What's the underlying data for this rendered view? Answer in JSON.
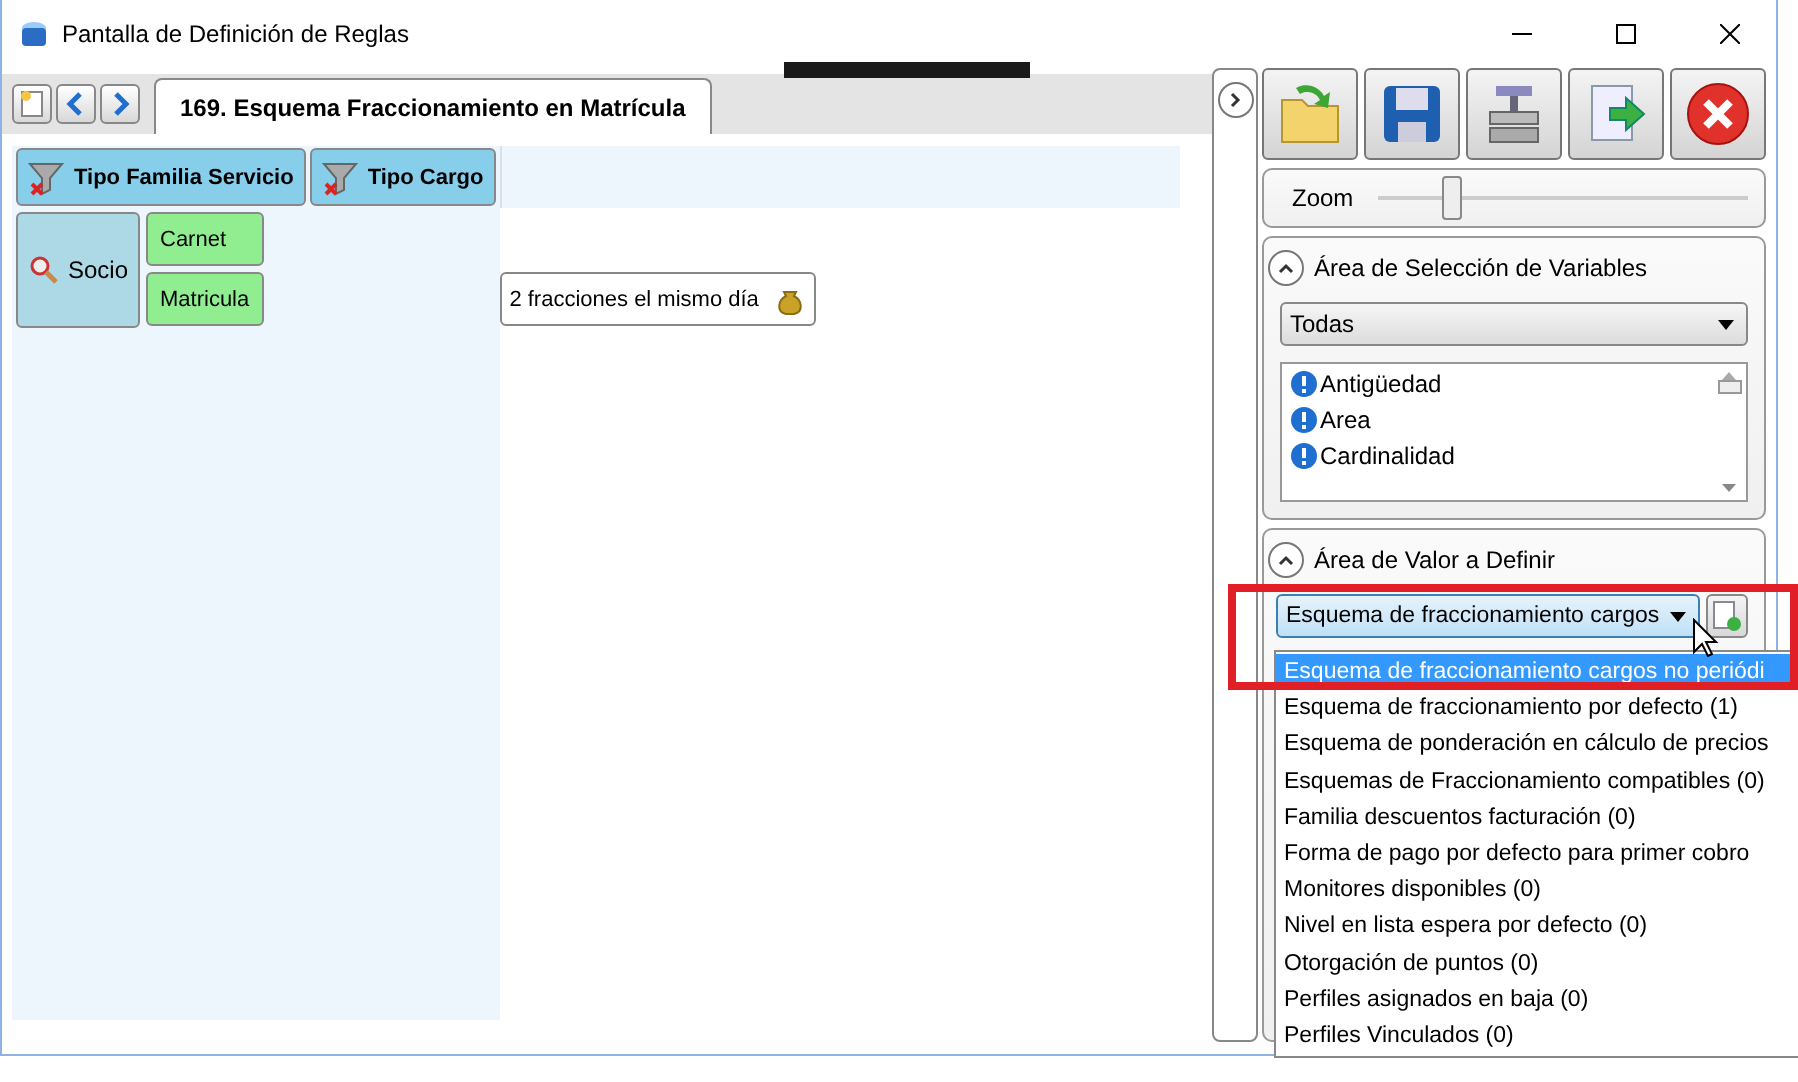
{
  "window": {
    "title": "Pantalla de Definición de Reglas"
  },
  "tabs": [
    {
      "label": "169. Esquema Fraccionamiento en Matrícula",
      "selected": true
    }
  ],
  "grid": {
    "column_headers": [
      "Tipo Familia Servicio",
      "Tipo Cargo"
    ],
    "row_header": "Socio",
    "row_values": [
      {
        "label": "Carnet"
      },
      {
        "label": "Matricula",
        "result": "2 fracciones el mismo día"
      }
    ]
  },
  "zoom": {
    "label": "Zoom",
    "level": 0.2
  },
  "variables": {
    "title": "Área de Selección de Variables",
    "filter": "Todas",
    "items": [
      "Antigüedad",
      "Area",
      "Cardinalidad"
    ]
  },
  "value_area": {
    "title": "Área de Valor a Definir",
    "value": "Esquema de fraccionamiento cargos",
    "options": [
      {
        "label": "Esquema de fraccionamiento cargos no periódi",
        "selected": true
      },
      {
        "label": "Esquema de fraccionamiento por defecto (1)",
        "selected": false
      },
      {
        "label": "Esquema de ponderación en cálculo de precios",
        "selected": false
      },
      {
        "label": "Esquemas de Fraccionamiento compatibles (0)",
        "selected": false
      },
      {
        "label": "Familia descuentos facturación (0)",
        "selected": false
      },
      {
        "label": "Forma de pago por defecto para primer cobro",
        "selected": false
      },
      {
        "label": "Monitores disponibles (0)",
        "selected": false
      },
      {
        "label": "Nivel en lista espera por defecto (0)",
        "selected": false
      },
      {
        "label": "Otorgación de puntos (0)",
        "selected": false
      },
      {
        "label": "Perfiles asignados en baja (0)",
        "selected": false
      },
      {
        "label": "Perfiles Vinculados (0)",
        "selected": false
      }
    ]
  }
}
